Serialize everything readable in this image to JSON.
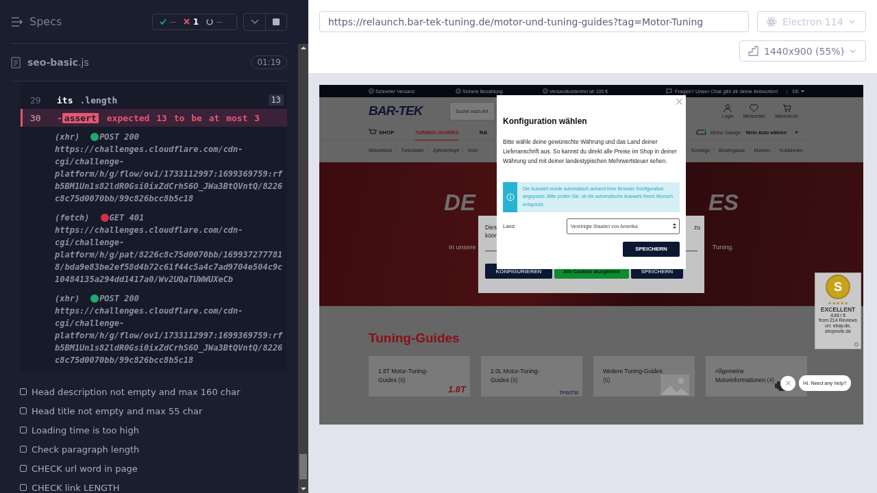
{
  "panel": {
    "title": "Specs",
    "stats": [
      {
        "kind": "passed",
        "value": "--"
      },
      {
        "kind": "failed",
        "value": "1"
      },
      {
        "kind": "pending",
        "value": "--"
      }
    ]
  },
  "spec": {
    "file": "**seo-basic**.js",
    "duration": "01:19"
  },
  "commands": [
    {
      "kind": "command",
      "number": "29",
      "name": "its",
      "message": ".length",
      "count": "13"
    },
    {
      "kind": "failed",
      "number": "30",
      "prefix": "-",
      "name": "assert",
      "message": "expected **13** to be at most **3**"
    }
  ],
  "requests": [
    {
      "type": "(xhr)",
      "color": "#1fa971",
      "status": "POST 200",
      "url": "https://challenges.cloudflare.com/cdn-cgi/challenge-platform/h/g/flow/ov1/1733112997:1699369759:rfb5BM1Un1s82ldR0Gsi0ixZdCrhS6O_JWa3BtQVntQ/8226c8c75d0070bb/99c826bcc8b5c18"
    },
    {
      "type": "(fetch)",
      "color": "#d22f4b",
      "status": "GET 401",
      "url": "https://challenges.cloudflare.com/cdn-cgi/challenge-platform/h/g/pat/8226c8c75d0070bb/1699372777818/bda9e83be2ef58d4b72c61f44c5a4c7ad9704e504c9c10484135a294dd1417a0/Wv2UQaTUWWUXeCb"
    },
    {
      "type": "(xhr)",
      "color": "#1fa971",
      "status": "POST 200",
      "url": "https://challenges.cloudflare.com/cdn-cgi/challenge-platform/h/g/flow/ov1/1733112997:1699369759:rfb5BM1Un1s82ldR0Gsi0ixZdCrhS6O_JWa3BtQVntQ/8226c8c75d0070bb/99c826bcc8b5c18"
    }
  ],
  "tests": [
    "Head description not empty and max 160 char",
    "Head title not empty and max 55 char",
    "Loading time is too high",
    "Check paragraph length",
    "CHECK url word in page",
    "CHECK link LENGTH"
  ],
  "browser": {
    "url": "https://relaunch.bar-tek-tuning.de/motor-und-tuning-guides?tag=Motor-Tuning",
    "name": "Electron 114",
    "viewport": "1440x900 (55%)"
  },
  "site": {
    "topbar": [
      "Schneller Versand",
      "Sichere Bezahlung",
      "Versandkostenfrei ab 100 €"
    ],
    "chat_hint": "Fragen? Unser Chat gibt dir deine Antworten!",
    "language": "DE",
    "logo": "BAR-TEK",
    "search_placeholder": "Suche nach Art",
    "actions": [
      {
        "kind": "user",
        "label": "Login"
      },
      {
        "kind": "heart",
        "label": "Merkzettel"
      },
      {
        "kind": "cart",
        "label": "Warenkorb"
      }
    ],
    "nav": [
      {
        "label": "SHOP",
        "selected": false
      },
      {
        "label": "TUNING-GUIDES",
        "selected": true
      },
      {
        "label": "RA",
        "selected": false
      }
    ],
    "garage": {
      "label": "Meine Garage:",
      "value": "Mein Auto wählen"
    },
    "categories_left": [
      "Motorblock",
      "Turbolader",
      "Zylinderkopf",
      "Kühl"
    ],
    "categories_right": [
      "Sonstige",
      "Boxengasse",
      "Marken",
      "% Aktionen"
    ],
    "hero": {
      "title_left": "DE",
      "title_right": "ES",
      "subtitle_left": "In unsere",
      "subtitle_right": "Tuning."
    },
    "cookie": {
      "text_left": [
        "Dies",
        "könn"
      ],
      "text_right": "zu",
      "buttons": [
        {
          "kind": "dark",
          "label": "KONFIGURIEREN"
        },
        {
          "kind": "accept",
          "label": "Alle Cookies akzeptieren"
        },
        {
          "kind": "dark",
          "label": "SPEICHERN"
        }
      ]
    },
    "section_title": "Tuning-Guides",
    "guides": [
      {
        "kind": "logo",
        "title": "1.8T Motor-Tuning-Guides",
        "count": "(8)",
        "logo": "1.8T",
        "color": "#7a1216"
      },
      {
        "kind": "logo",
        "title": "2.0L Motor-Tuning-Guides",
        "count": "(6)",
        "logo": "TFSI/TSI",
        "color": "#1c2550"
      },
      {
        "kind": "image",
        "title": "Weitere Tuning-Guides",
        "count": "(5)"
      },
      {
        "kind": "engine",
        "title": "Allgemeine Motorinformationen",
        "count": "(4)"
      }
    ],
    "rating": {
      "letter": "S",
      "stars": 5,
      "label": "EXCELLENT",
      "score": "4.93 / 5",
      "note": "from 214 Reviews on: ebay.de, shopvote.de"
    },
    "chat": {
      "message": "Hi. Need any help?"
    },
    "modal": {
      "title": "Konfiguration wählen",
      "text": "Bitte wähle deine gewünschte Währung und das Land deiner Lieferanschrift aus. So kannst du direkt alle Preise im Shop in deiner Währung und mit deiner landestypischen Mehrwertsteuer sehen.",
      "info": "Die Auswahl wurde automatisch anhand Ihrer Browser Konfiguration angepasst. Bitte prüfen Sie, ob die automatische Auswahl Ihrem Wunsch entspricht.",
      "field_label": "Land:",
      "field_value": "Vereinigte Staaten von Amerika",
      "button": "SPEICHERN"
    }
  }
}
